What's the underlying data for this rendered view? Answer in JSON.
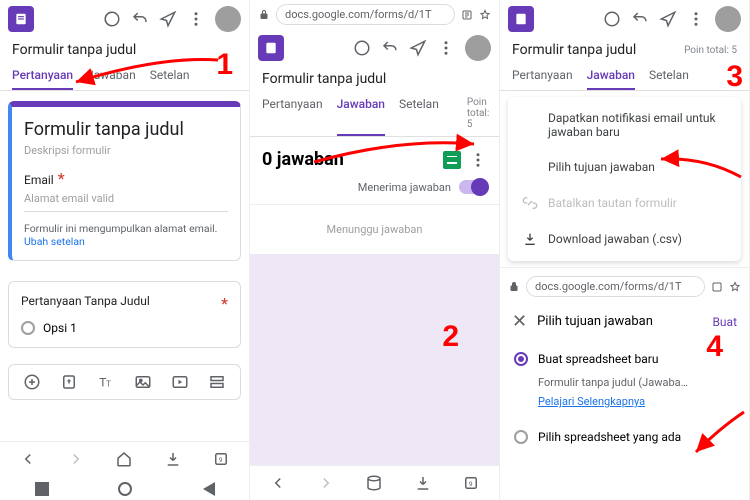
{
  "common": {
    "form_title": "Formulir tanpa judul",
    "tabs": {
      "questions": "Pertanyaan",
      "responses": "Jawaban",
      "settings": "Setelan"
    },
    "points_total": "Poin total: 5",
    "url": "docs.google.com/forms/d/1T"
  },
  "panel1": {
    "form_title_field": "Formulir tanpa judul",
    "desc_placeholder": "Deskripsi formulir",
    "email_label": "Email",
    "email_placeholder": "Alamat email valid",
    "email_hint_pre": "Formulir ini mengumpulkan alamat email.  ",
    "email_hint_link": "Ubah setelan",
    "question_label": "Pertanyaan Tanpa Judul",
    "option1": "Opsi 1"
  },
  "panel2": {
    "response_count": "0 jawaban",
    "accepting": "Menerima jawaban",
    "waiting": "Menunggu jawaban"
  },
  "panel3": {
    "menu": {
      "notify": "Dapatkan notifikasi email untuk jawaban baru",
      "dest": "Pilih tujuan jawaban",
      "unlink": "Batalkan tautan formulir",
      "download": "Download jawaban (.csv)"
    },
    "sheet": {
      "title": "Pilih tujuan jawaban",
      "create_action": "Buat",
      "opt_new": "Buat spreadsheet baru",
      "opt_new_sub": "Formulir tanpa judul (Jawaba…",
      "learn": "Pelajari Selengkapnya",
      "opt_existing": "Pilih spreadsheet yang ada"
    }
  },
  "steps": {
    "s1": "1",
    "s2": "2",
    "s3": "3",
    "s4": "4"
  }
}
